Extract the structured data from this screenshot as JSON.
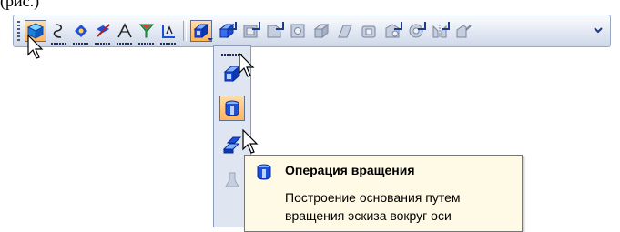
{
  "page": {
    "top_text": "(рис.)"
  },
  "toolbar": {
    "left_buttons": [
      {
        "icon": "cube-icon",
        "active": true
      },
      {
        "icon": "curve-icon"
      },
      {
        "icon": "point-icon"
      },
      {
        "icon": "axis-icon"
      },
      {
        "icon": "plane-angle-icon"
      },
      {
        "icon": "filter-icon"
      },
      {
        "icon": "measure-icon"
      }
    ],
    "right_buttons": [
      {
        "icon": "extrude-icon",
        "active": true
      },
      {
        "icon": "sketch-extrude-icon"
      },
      {
        "icon": "shell-icon"
      },
      {
        "icon": "fillet-icon"
      },
      {
        "icon": "hole-icon"
      },
      {
        "icon": "cut-icon"
      },
      {
        "icon": "loft-icon"
      },
      {
        "icon": "rib-icon"
      },
      {
        "icon": "draft-icon"
      },
      {
        "icon": "array-icon"
      },
      {
        "icon": "mirror-icon"
      },
      {
        "icon": "properties-icon"
      }
    ]
  },
  "flyout": {
    "items": [
      {
        "icon": "extrude-operation-icon"
      },
      {
        "icon": "revolve-operation-icon",
        "active": true
      },
      {
        "icon": "kinematic-operation-icon"
      },
      {
        "icon": "loft-operation-icon",
        "disabled": true
      }
    ]
  },
  "tooltip": {
    "title": "Операция вращения",
    "line1": "Построение основания путем",
    "line2": "вращения эскиза вокруг оси",
    "icon": "revolve-operation-icon"
  },
  "colors": {
    "active_fill": "#ffb35c",
    "tooltip_bg": "#fffae6",
    "icon_blue": "#1d4fd8"
  }
}
